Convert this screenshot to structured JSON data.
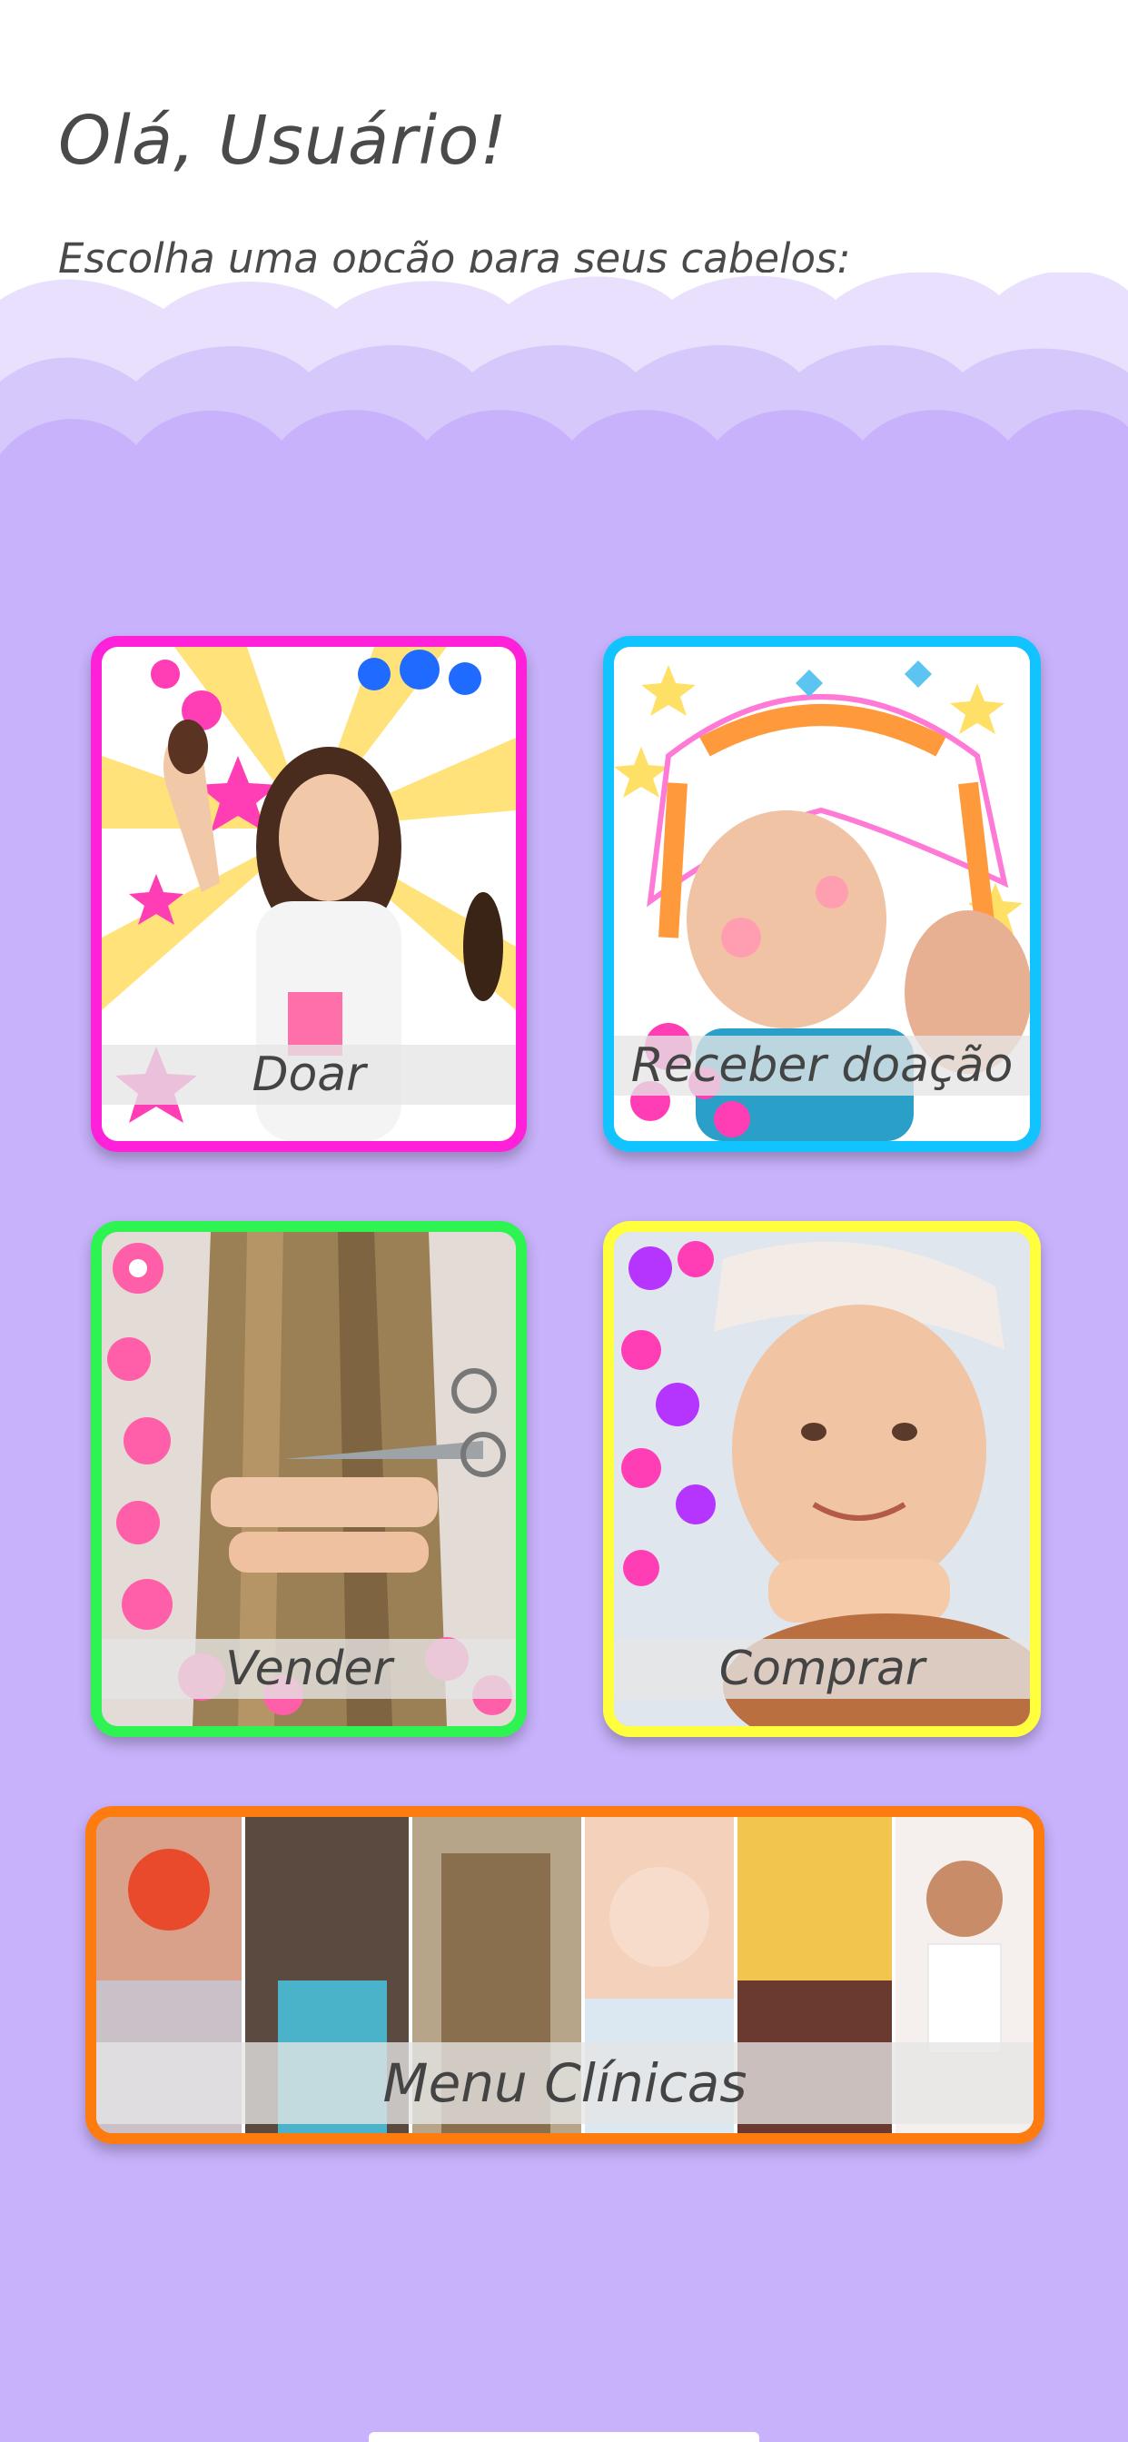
{
  "header": {
    "greeting": "Olá, Usuário!",
    "subtitle": "Escolha uma opção para seus cabelos:"
  },
  "options": {
    "doar": {
      "label": "Doar",
      "border_color": "#ff21d9"
    },
    "receber": {
      "label": "Receber doação",
      "border_color": "#11c3ff"
    },
    "vender": {
      "label": "Vender",
      "border_color": "#2ef452"
    },
    "comprar": {
      "label": "Comprar",
      "border_color": "#ffff3d"
    },
    "clinicas": {
      "label": "Menu Clínicas",
      "border_color": "#fe7b10"
    }
  },
  "colors": {
    "background": "#c7b2fb",
    "cloud_light": "#e8e0fc",
    "cloud_mid": "#d6c8fb",
    "text": "#4a4a4a"
  }
}
